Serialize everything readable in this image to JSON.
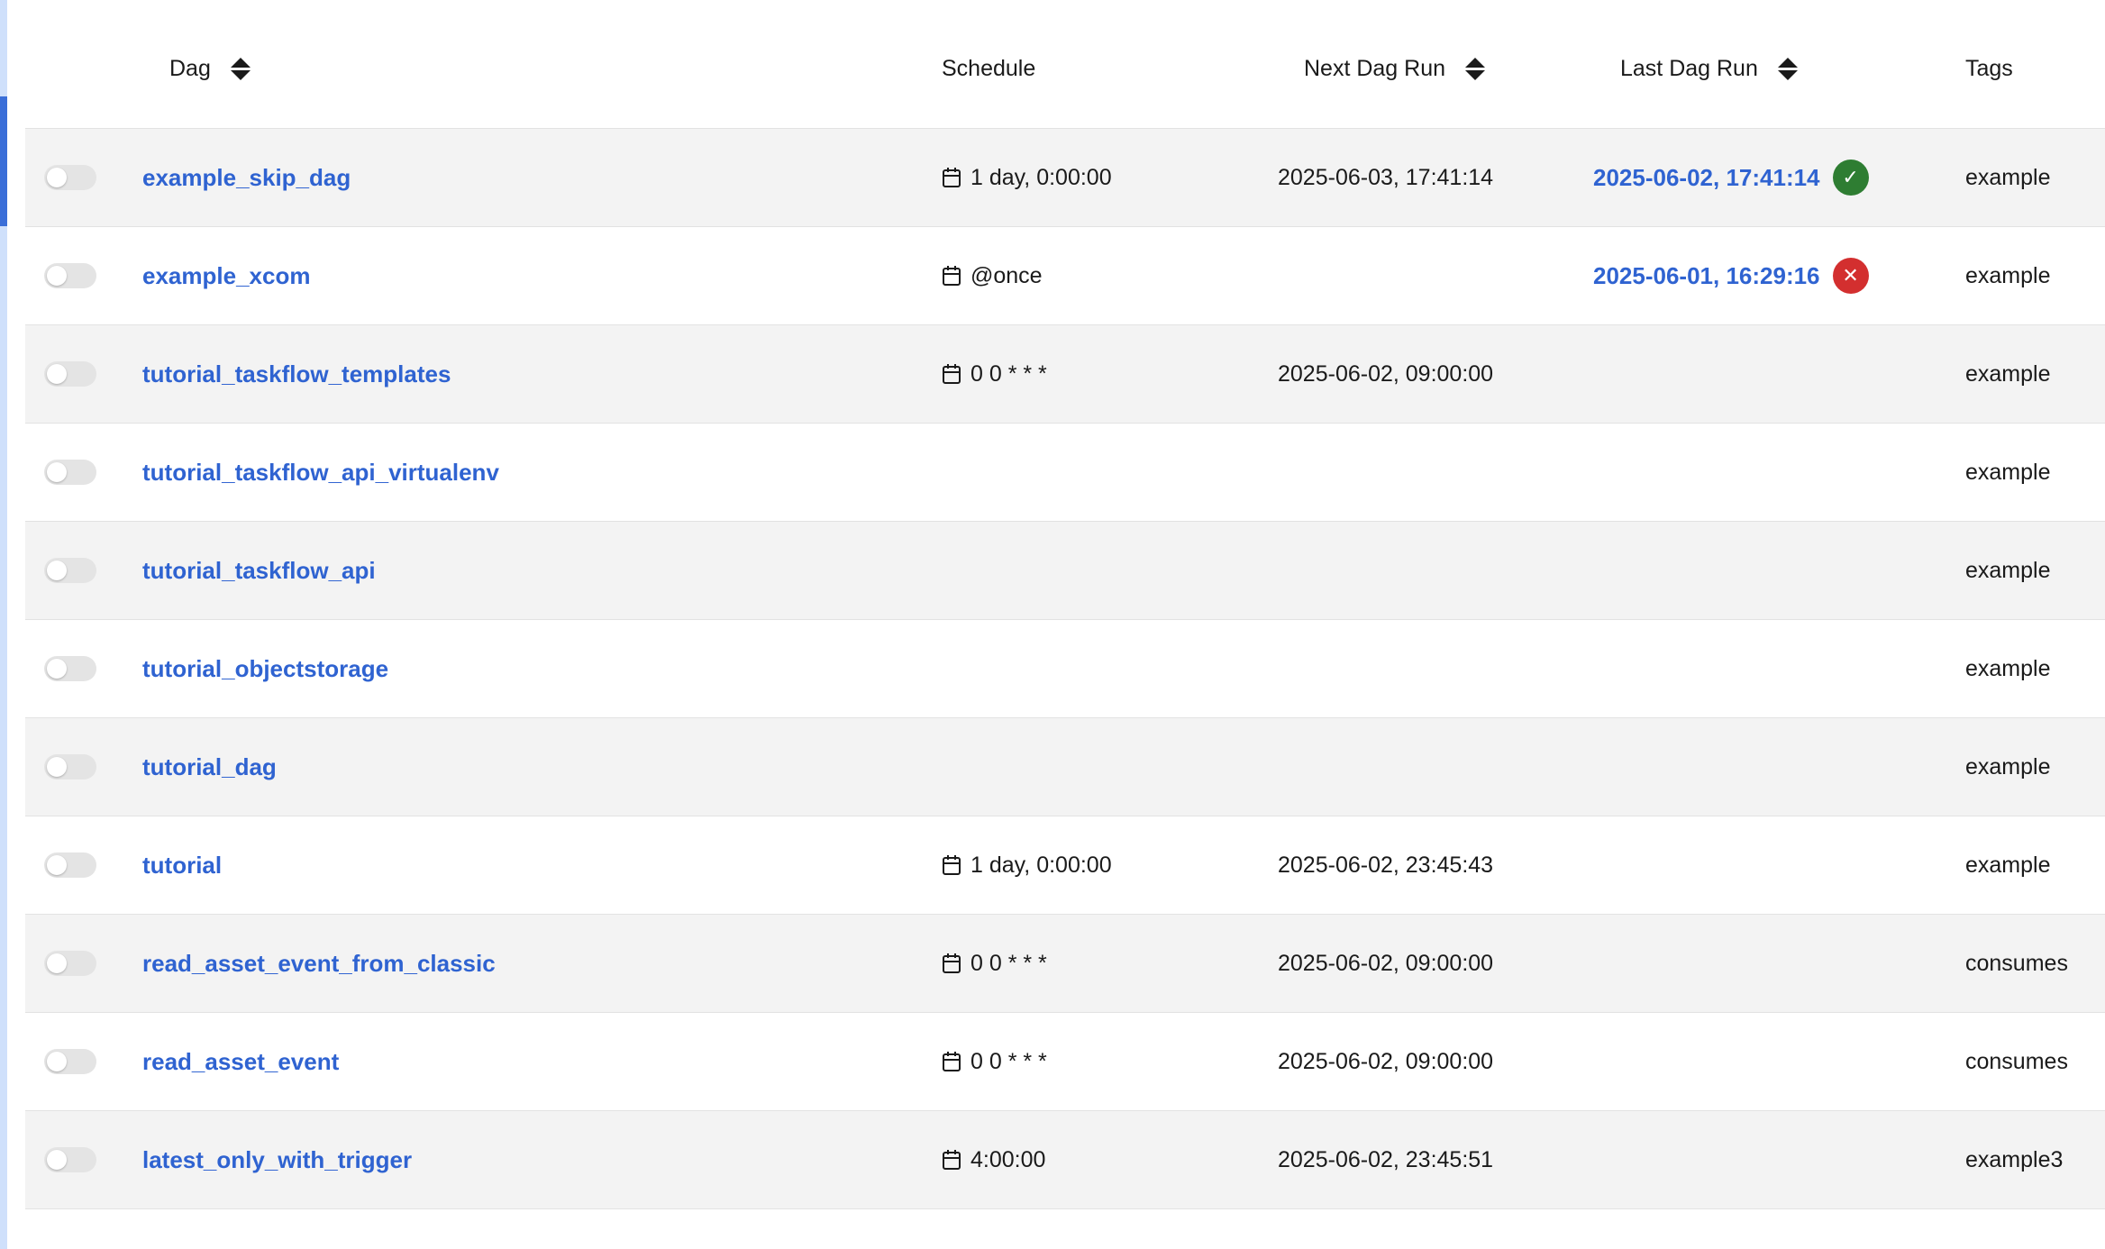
{
  "headers": {
    "dag": "Dag",
    "schedule": "Schedule",
    "next_run": "Next Dag Run",
    "last_run": "Last Dag Run",
    "tags": "Tags"
  },
  "rows": [
    {
      "dag": "example_skip_dag",
      "schedule": "1 day, 0:00:00",
      "next_run": "2025-06-03, 17:41:14",
      "last_run": "2025-06-02, 17:41:14",
      "last_status": "success",
      "tag": "example"
    },
    {
      "dag": "example_xcom",
      "schedule": "@once",
      "next_run": "",
      "last_run": "2025-06-01, 16:29:16",
      "last_status": "failed",
      "tag": "example"
    },
    {
      "dag": "tutorial_taskflow_templates",
      "schedule": "0 0 * * *",
      "next_run": "2025-06-02, 09:00:00",
      "last_run": "",
      "last_status": "",
      "tag": "example"
    },
    {
      "dag": "tutorial_taskflow_api_virtualenv",
      "schedule": "",
      "next_run": "",
      "last_run": "",
      "last_status": "",
      "tag": "example"
    },
    {
      "dag": "tutorial_taskflow_api",
      "schedule": "",
      "next_run": "",
      "last_run": "",
      "last_status": "",
      "tag": "example"
    },
    {
      "dag": "tutorial_objectstorage",
      "schedule": "",
      "next_run": "",
      "last_run": "",
      "last_status": "",
      "tag": "example"
    },
    {
      "dag": "tutorial_dag",
      "schedule": "",
      "next_run": "",
      "last_run": "",
      "last_status": "",
      "tag": "example"
    },
    {
      "dag": "tutorial",
      "schedule": "1 day, 0:00:00",
      "next_run": "2025-06-02, 23:45:43",
      "last_run": "",
      "last_status": "",
      "tag": "example"
    },
    {
      "dag": "read_asset_event_from_classic",
      "schedule": "0 0 * * *",
      "next_run": "2025-06-02, 09:00:00",
      "last_run": "",
      "last_status": "",
      "tag": "consumes"
    },
    {
      "dag": "read_asset_event",
      "schedule": "0 0 * * *",
      "next_run": "2025-06-02, 09:00:00",
      "last_run": "",
      "last_status": "",
      "tag": "consumes"
    },
    {
      "dag": "latest_only_with_trigger",
      "schedule": "4:00:00",
      "next_run": "2025-06-02, 23:45:51",
      "last_run": "",
      "last_status": "",
      "tag": "example3"
    }
  ],
  "colors": {
    "link": "#2f63d1",
    "success": "#2e7d32",
    "failed": "#d32f2f",
    "row_alt": "#f3f3f3"
  },
  "icons": {
    "sort": "sort-icon",
    "schedule": "calendar-icon",
    "success": "check-circle-icon",
    "failed": "x-circle-icon"
  }
}
